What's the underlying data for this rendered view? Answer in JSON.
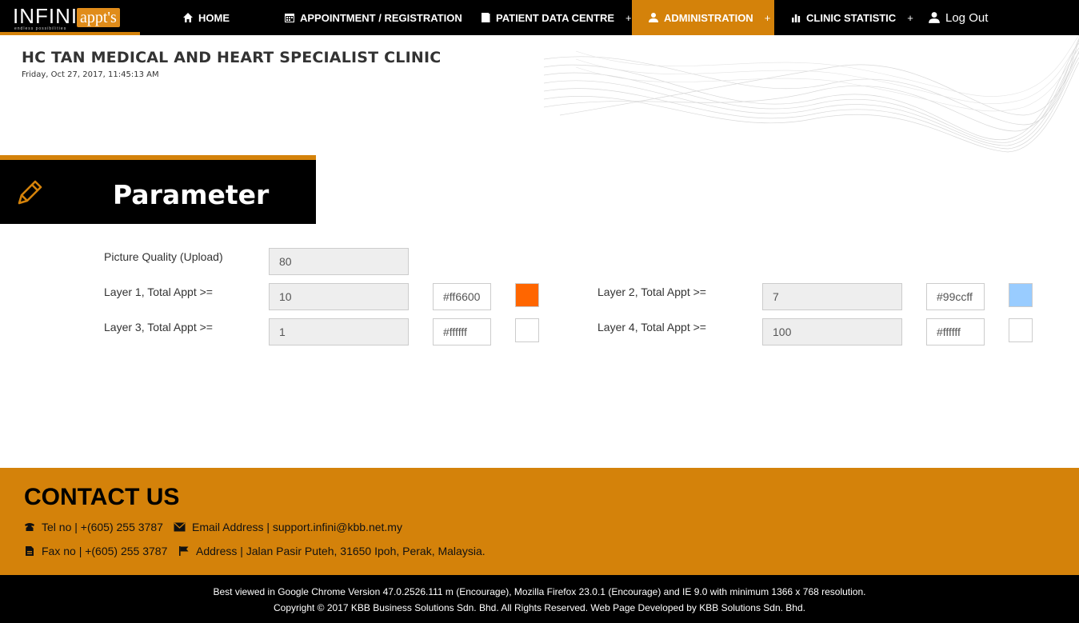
{
  "logo": {
    "main": "INFINI",
    "badge": "appt's",
    "tagline": "endless possibilities"
  },
  "nav": {
    "home": "HOME",
    "appointment": "APPOINTMENT / REGISTRATION",
    "patient": "PATIENT DATA CENTRE",
    "administration": "ADMINISTRATION",
    "statistic": "CLINIC STATISTIC",
    "logout": "Log Out",
    "plus": "+"
  },
  "header": {
    "clinic_name": "HC TAN MEDICAL AND HEART SPECIALIST CLINIC",
    "datetime": "Friday, Oct 27, 2017, 11:45:13 AM"
  },
  "page": {
    "title": "Parameter"
  },
  "form": {
    "picture_quality": {
      "label": "Picture Quality (Upload)",
      "value": "80"
    },
    "layer1": {
      "label": "Layer 1, Total Appt >=",
      "value": "10",
      "color": "#ff6600"
    },
    "layer2": {
      "label": "Layer 2, Total Appt >=",
      "value": "7",
      "color": "#99ccff"
    },
    "layer3": {
      "label": "Layer 3, Total Appt >=",
      "value": "1",
      "color": "#ffffff"
    },
    "layer4": {
      "label": "Layer 4, Total Appt >=",
      "value": "100",
      "color": "#ffffff"
    }
  },
  "contact": {
    "title": "CONTACT US",
    "tel": "Tel no | +(605) 255 3787",
    "email": "Email Address | support.infini@kbb.net.my",
    "fax": "Fax no | +(605) 255 3787",
    "address": "Address | Jalan Pasir Puteh, 31650 Ipoh, Perak, Malaysia."
  },
  "footer": {
    "line1": "Best viewed in Google Chrome Version 47.0.2526.111 m (Encourage), Mozilla Firefox 23.0.1 (Encourage) and IE 9.0 with minimum 1366 x 768 resolution.",
    "line2": "Copyright © 2017 KBB Business Solutions Sdn. Bhd. All Rights Reserved. Web Page Developed by KBB Solutions Sdn. Bhd."
  },
  "colors": {
    "accent": "#d4820a",
    "nav_bg": "#000000"
  },
  "icons": [
    "home-icon",
    "calendar-icon",
    "book-icon",
    "user-icon",
    "bar-chart-icon",
    "pencil-icon",
    "phone-icon",
    "envelope-icon",
    "fax-icon",
    "flag-icon"
  ]
}
